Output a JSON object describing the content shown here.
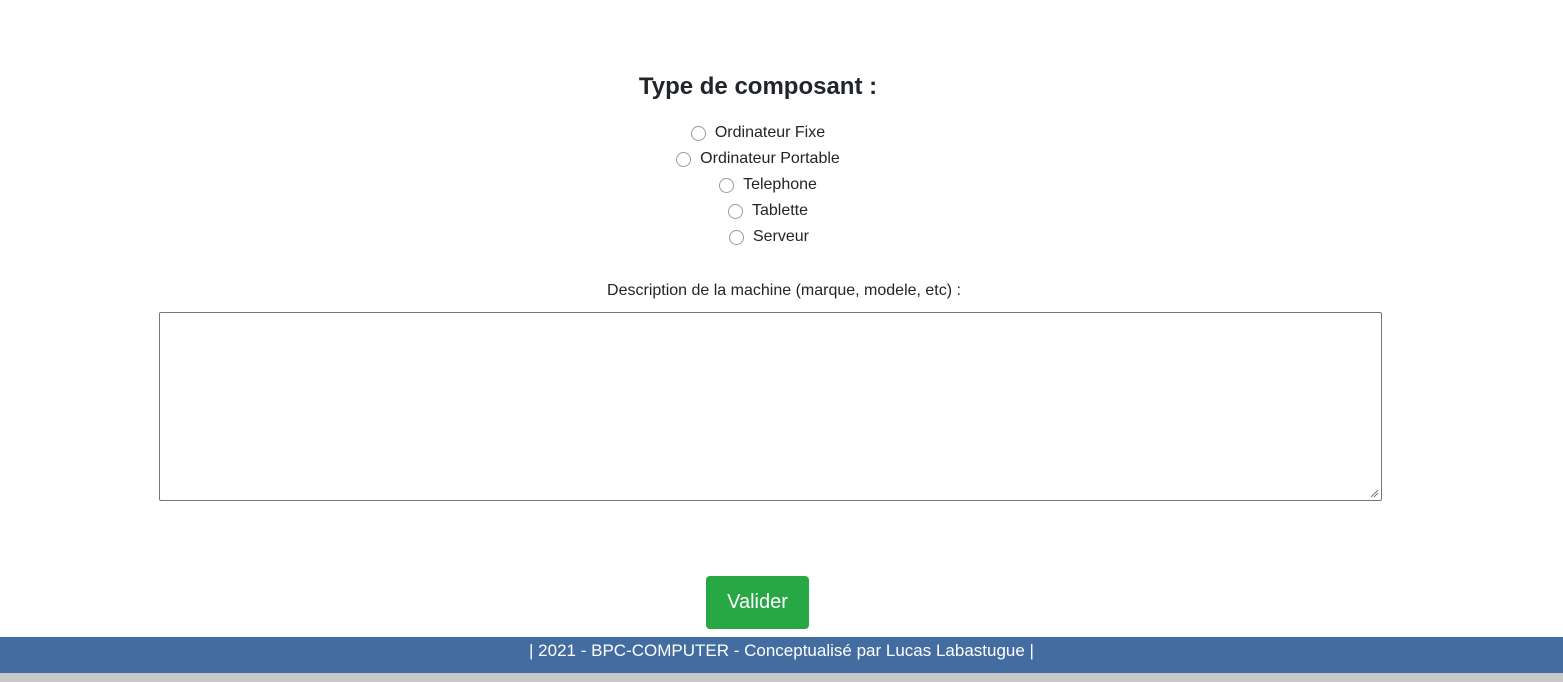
{
  "form": {
    "component_type_title": "Type de composant :",
    "component_types": [
      {
        "label": "Ordinateur Fixe",
        "selected": false
      },
      {
        "label": "Ordinateur Portable",
        "selected": false
      },
      {
        "label": "Telephone",
        "selected": false
      },
      {
        "label": "Tablette",
        "selected": false
      },
      {
        "label": "Serveur",
        "selected": false
      }
    ],
    "description_label": "Description de la machine (marque, modele, etc) :",
    "description_value": "",
    "submit_label": "Valider"
  },
  "footer": {
    "text": "| 2021 - BPC-COMPUTER - Conceptualisé par Lucas Labastugue |"
  },
  "colors": {
    "submit_button": "#28a745",
    "footer_background": "#436da0",
    "footer_text": "#ffffff"
  }
}
